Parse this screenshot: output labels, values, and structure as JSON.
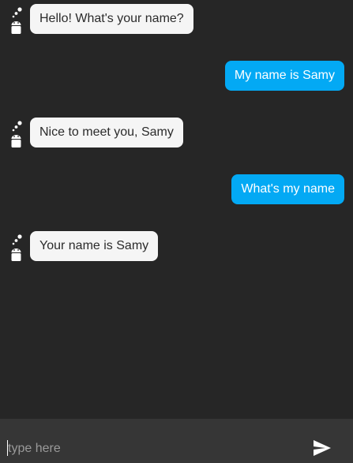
{
  "colors": {
    "background": "#262626",
    "composer_background": "#363636",
    "bot_bubble": "#f5f5f5",
    "bot_text": "#2b2b2b",
    "user_bubble": "#03a9f4",
    "user_text": "#ffffff",
    "icon": "#ffffff"
  },
  "messages": [
    {
      "sender": "bot",
      "text": "Hello! What's your name?",
      "avatar_icon": "robot-icon"
    },
    {
      "sender": "user",
      "text": "My name is Samy"
    },
    {
      "sender": "bot",
      "text": "Nice to meet you, Samy",
      "avatar_icon": "robot-icon"
    },
    {
      "sender": "user",
      "text": "What's my name"
    },
    {
      "sender": "bot",
      "text": "Your name is Samy",
      "avatar_icon": "robot-icon"
    }
  ],
  "composer": {
    "value": "",
    "placeholder": "type here",
    "send_icon": "send-icon"
  }
}
